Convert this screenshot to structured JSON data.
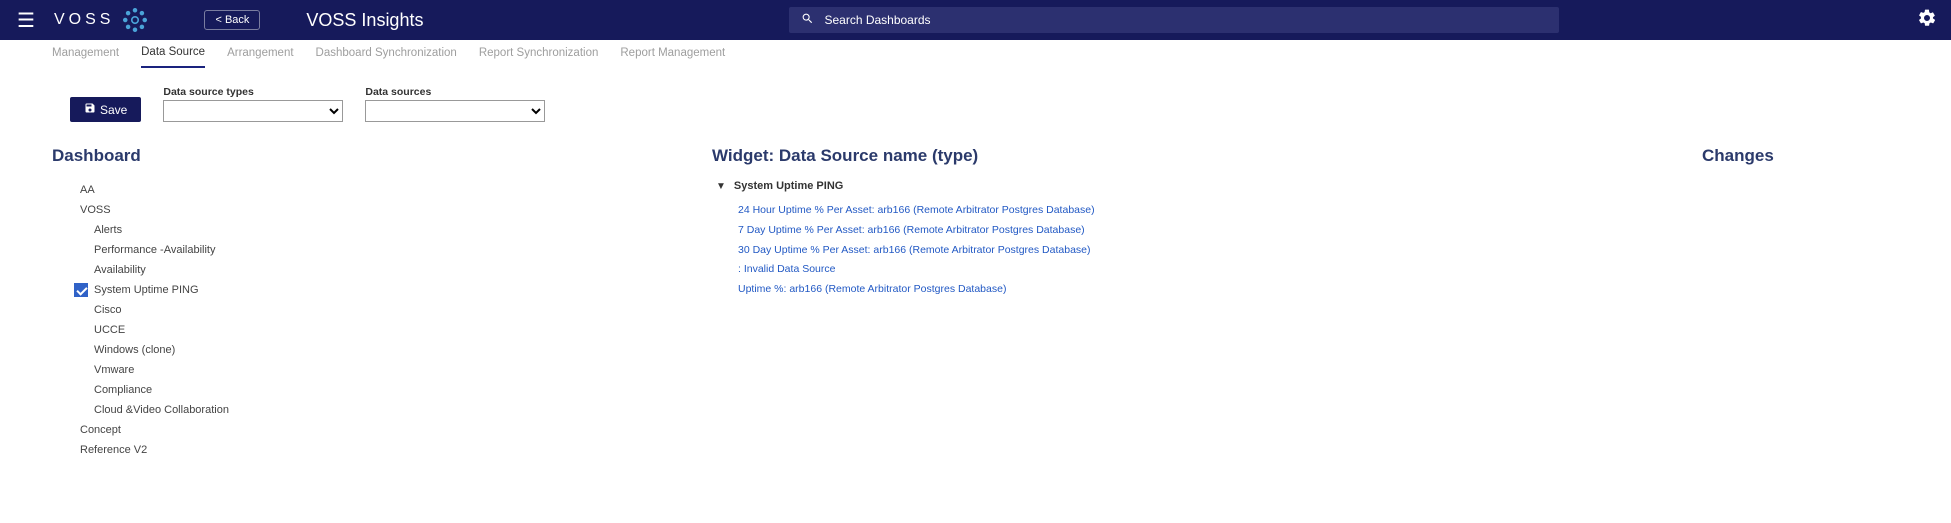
{
  "appbar": {
    "brand_text": "VOSS",
    "back_label": "< Back",
    "app_title": "VOSS Insights",
    "search_placeholder": "Search Dashboards"
  },
  "tabs": {
    "items": [
      {
        "label": "Management",
        "active": false
      },
      {
        "label": "Data Source",
        "active": true
      },
      {
        "label": "Arrangement",
        "active": false
      },
      {
        "label": "Dashboard Synchronization",
        "active": false
      },
      {
        "label": "Report Synchronization",
        "active": false
      },
      {
        "label": "Report Management",
        "active": false
      }
    ]
  },
  "toolbar": {
    "save_label": "Save",
    "data_source_types_label": "Data source types",
    "data_sources_label": "Data sources"
  },
  "columns": {
    "dashboard_title": "Dashboard",
    "widget_title": "Widget: Data Source name (type)",
    "changes_title": "Changes"
  },
  "dashboard_tree": [
    {
      "label": "AA",
      "indent": 0,
      "checked": false,
      "has_check": false
    },
    {
      "label": "VOSS",
      "indent": 0,
      "checked": false,
      "has_check": false
    },
    {
      "label": "Alerts",
      "indent": 2,
      "checked": false,
      "has_check": false
    },
    {
      "label": "Performance -Availability",
      "indent": 2,
      "checked": false,
      "has_check": false
    },
    {
      "label": "Availability",
      "indent": 3,
      "checked": false,
      "has_check": false
    },
    {
      "label": "System Uptime PING",
      "indent": 3,
      "checked": true,
      "has_check": true
    },
    {
      "label": "Cisco",
      "indent": 3,
      "checked": false,
      "has_check": false
    },
    {
      "label": "UCCE",
      "indent": 2,
      "checked": false,
      "has_check": false
    },
    {
      "label": "Windows (clone)",
      "indent": 3,
      "checked": false,
      "has_check": false
    },
    {
      "label": "Vmware",
      "indent": 3,
      "checked": false,
      "has_check": false
    },
    {
      "label": "Compliance",
      "indent": 2,
      "checked": false,
      "has_check": false
    },
    {
      "label": "Cloud &Video Collaboration",
      "indent": 2,
      "checked": false,
      "has_check": false
    },
    {
      "label": "Concept",
      "indent": 0,
      "checked": false,
      "has_check": false
    },
    {
      "label": "Reference V2",
      "indent": 0,
      "checked": false,
      "has_check": false
    }
  ],
  "widget": {
    "header": "System Uptime PING",
    "items": [
      "24 Hour Uptime % Per Asset: arb166 (Remote Arbitrator Postgres Database)",
      "7 Day Uptime % Per Asset: arb166 (Remote Arbitrator Postgres Database)",
      "30 Day Uptime % Per Asset: arb166 (Remote Arbitrator Postgres Database)",
      ": Invalid Data Source",
      "Uptime %: arb166 (Remote Arbitrator Postgres Database)"
    ]
  }
}
